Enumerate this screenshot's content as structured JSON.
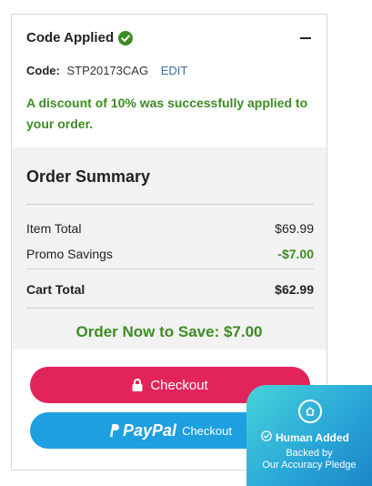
{
  "promo": {
    "title": "Code Applied",
    "code_label": "Code:",
    "code_value": "STP20173CAG",
    "edit_label": "EDIT",
    "message": "A discount of 10% was successfully applied to your order."
  },
  "summary": {
    "title": "Order Summary",
    "rows": [
      {
        "label": "Item Total",
        "value": "$69.99"
      },
      {
        "label": "Promo Savings",
        "value": "-$7.00"
      }
    ],
    "total": {
      "label": "Cart Total",
      "value": "$62.99"
    },
    "save_banner": "Order Now to Save: $7.00"
  },
  "buttons": {
    "checkout_label": "Checkout",
    "paypal_brand": "PayPal",
    "paypal_label": "Checkout"
  },
  "badge": {
    "title": "Human Added",
    "subtitle_line1": "Backed by",
    "subtitle_line2": "Our Accuracy Pledge"
  },
  "colors": {
    "accent_green": "#3d8c23",
    "checkout_pink": "#e3245a",
    "paypal_blue": "#1e9fe0",
    "edit_link": "#3a6ea5"
  },
  "icons": [
    "check-circle-icon",
    "minus-icon",
    "lock-icon",
    "paypal-p-icon",
    "house-icon",
    "check-circle-outline-icon"
  ]
}
